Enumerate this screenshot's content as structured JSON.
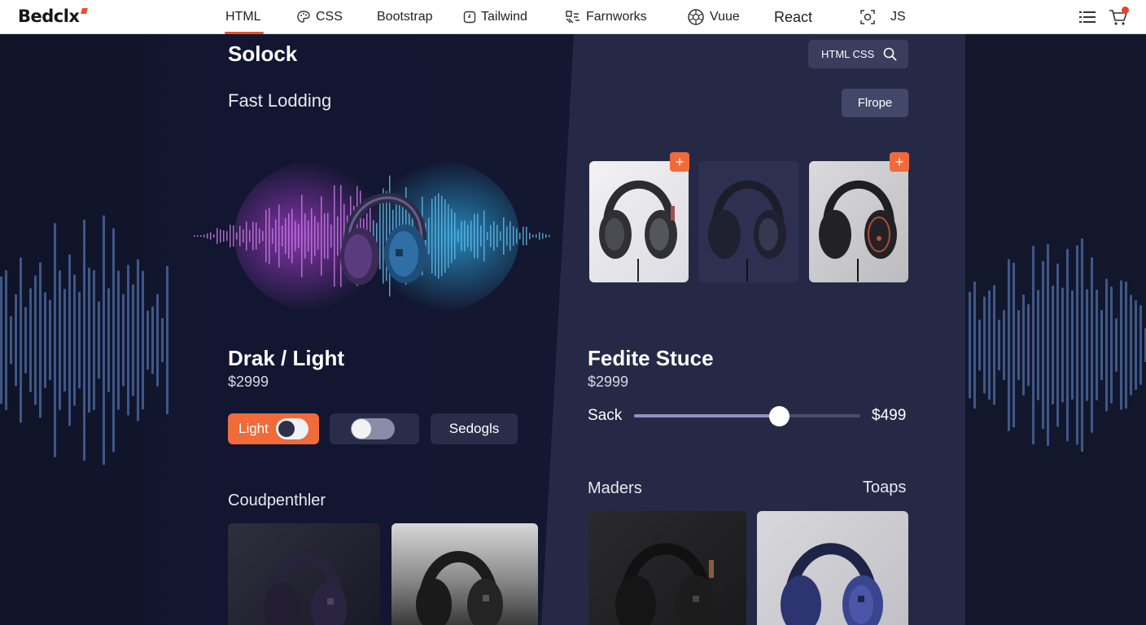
{
  "brand": {
    "name": "Bedclx",
    "accent": "#e9502f"
  },
  "nav": {
    "items": [
      {
        "label": "HTML",
        "icon": ""
      },
      {
        "label": "CSS",
        "icon": "palette-icon"
      },
      {
        "label": "Bootstrap",
        "icon": ""
      },
      {
        "label": "Tailwind",
        "icon": "tailwind-icon"
      },
      {
        "label": "Farnworks",
        "icon": "frameworks-icon"
      },
      {
        "label": "Vuue",
        "icon": "vue-icon"
      },
      {
        "label": "React",
        "icon": ""
      },
      {
        "label": "JS",
        "icon": "js-icon"
      }
    ],
    "active": "HTML",
    "right_icons": [
      "menu-icon",
      "cart-icon"
    ]
  },
  "left": {
    "title": "Solock",
    "subtitle": "Fast Lodding",
    "theme_heading": "Drak / Light",
    "theme_price": "$2999",
    "light_button": "Light",
    "settings_button": "Sedogls",
    "gallery_heading": "Coudpenthler"
  },
  "right": {
    "search_text": "HTML CSS",
    "europe_button": "Flrope",
    "product_heading": "Fedite Stuce",
    "product_price": "$2999",
    "slider_label": "Sack",
    "slider_value": "$499",
    "slider_level": 0.64,
    "section_left": "Maders",
    "section_right": "Toaps"
  },
  "colors": {
    "accent": "#f06a3a",
    "panel": "#262946",
    "background": "#0f1225",
    "button": "#2a2d4a"
  }
}
